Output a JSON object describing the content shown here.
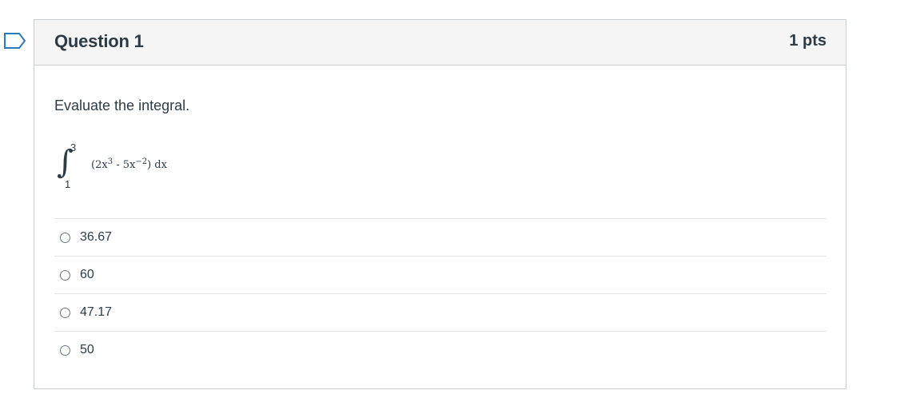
{
  "question": {
    "title": "Question 1",
    "points": "1 pts",
    "prompt": "Evaluate the integral.",
    "integral": {
      "upper_limit": "3",
      "lower_limit": "1",
      "integrand_prefix": "(2x",
      "exp1": "3",
      "integrand_mid": " - 5x",
      "exp2": "−2",
      "integrand_suffix": ") dx"
    },
    "answers": [
      {
        "label": "36.67",
        "selected": false
      },
      {
        "label": "60",
        "selected": false
      },
      {
        "label": "47.17",
        "selected": false
      },
      {
        "label": "50",
        "selected": false
      }
    ]
  },
  "icons": {
    "flag": "bookmark-flag-icon"
  },
  "colors": {
    "flag_stroke": "#2b7abc",
    "header_bg": "#f5f5f5",
    "border": "#c7cdd1",
    "text": "#2d3b45"
  }
}
